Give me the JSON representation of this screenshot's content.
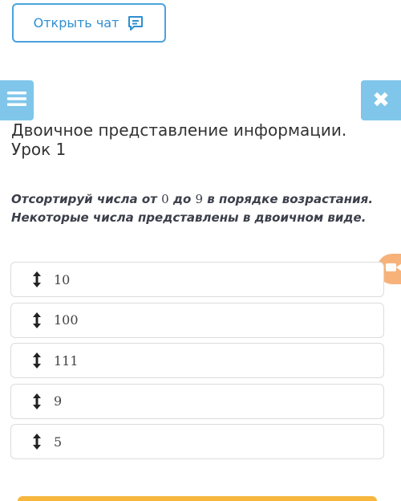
{
  "chat": {
    "label": "Открыть чат",
    "icon": "chat-icon"
  },
  "menu": {
    "icon": "hamburger-icon"
  },
  "close": {
    "icon": "close-icon",
    "glyph": "✖"
  },
  "title": "Двоичное представление информации. Урок 1",
  "task": {
    "part1": "Отсортируй числа от ",
    "num_from": "0",
    "part2": " до ",
    "num_to": "9",
    "part3": " в порядке возрастания. Некоторые числа представлены в двоичном виде."
  },
  "video_badge": {
    "icon": "video-camera-icon"
  },
  "items": [
    {
      "value": "10",
      "icon": "drag-handle-icon"
    },
    {
      "value": "100",
      "icon": "drag-handle-icon"
    },
    {
      "value": "111",
      "icon": "drag-handle-icon"
    },
    {
      "value": "9",
      "icon": "drag-handle-icon"
    },
    {
      "value": "5",
      "icon": "drag-handle-icon"
    }
  ],
  "colors": {
    "accent": "#4aa3dc",
    "nav_button": "#80c6ea",
    "video_badge": "#f7b27a",
    "bottom_bar": "#f6b73c"
  }
}
